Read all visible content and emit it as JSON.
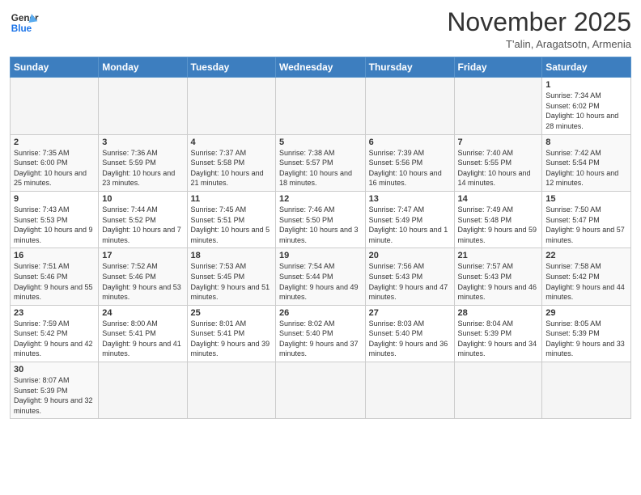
{
  "logo": {
    "text_general": "General",
    "text_blue": "Blue"
  },
  "header": {
    "month_title": "November 2025",
    "subtitle": "T'alin, Aragatsotn, Armenia"
  },
  "weekdays": [
    "Sunday",
    "Monday",
    "Tuesday",
    "Wednesday",
    "Thursday",
    "Friday",
    "Saturday"
  ],
  "weeks": [
    [
      {
        "day": "",
        "empty": true
      },
      {
        "day": "",
        "empty": true
      },
      {
        "day": "",
        "empty": true
      },
      {
        "day": "",
        "empty": true
      },
      {
        "day": "",
        "empty": true
      },
      {
        "day": "",
        "empty": true
      },
      {
        "day": "1",
        "sunrise": "Sunrise: 7:34 AM",
        "sunset": "Sunset: 6:02 PM",
        "daylight": "Daylight: 10 hours and 28 minutes."
      }
    ],
    [
      {
        "day": "2",
        "sunrise": "Sunrise: 7:35 AM",
        "sunset": "Sunset: 6:00 PM",
        "daylight": "Daylight: 10 hours and 25 minutes."
      },
      {
        "day": "3",
        "sunrise": "Sunrise: 7:36 AM",
        "sunset": "Sunset: 5:59 PM",
        "daylight": "Daylight: 10 hours and 23 minutes."
      },
      {
        "day": "4",
        "sunrise": "Sunrise: 7:37 AM",
        "sunset": "Sunset: 5:58 PM",
        "daylight": "Daylight: 10 hours and 21 minutes."
      },
      {
        "day": "5",
        "sunrise": "Sunrise: 7:38 AM",
        "sunset": "Sunset: 5:57 PM",
        "daylight": "Daylight: 10 hours and 18 minutes."
      },
      {
        "day": "6",
        "sunrise": "Sunrise: 7:39 AM",
        "sunset": "Sunset: 5:56 PM",
        "daylight": "Daylight: 10 hours and 16 minutes."
      },
      {
        "day": "7",
        "sunrise": "Sunrise: 7:40 AM",
        "sunset": "Sunset: 5:55 PM",
        "daylight": "Daylight: 10 hours and 14 minutes."
      },
      {
        "day": "8",
        "sunrise": "Sunrise: 7:42 AM",
        "sunset": "Sunset: 5:54 PM",
        "daylight": "Daylight: 10 hours and 12 minutes."
      }
    ],
    [
      {
        "day": "9",
        "sunrise": "Sunrise: 7:43 AM",
        "sunset": "Sunset: 5:53 PM",
        "daylight": "Daylight: 10 hours and 9 minutes."
      },
      {
        "day": "10",
        "sunrise": "Sunrise: 7:44 AM",
        "sunset": "Sunset: 5:52 PM",
        "daylight": "Daylight: 10 hours and 7 minutes."
      },
      {
        "day": "11",
        "sunrise": "Sunrise: 7:45 AM",
        "sunset": "Sunset: 5:51 PM",
        "daylight": "Daylight: 10 hours and 5 minutes."
      },
      {
        "day": "12",
        "sunrise": "Sunrise: 7:46 AM",
        "sunset": "Sunset: 5:50 PM",
        "daylight": "Daylight: 10 hours and 3 minutes."
      },
      {
        "day": "13",
        "sunrise": "Sunrise: 7:47 AM",
        "sunset": "Sunset: 5:49 PM",
        "daylight": "Daylight: 10 hours and 1 minute."
      },
      {
        "day": "14",
        "sunrise": "Sunrise: 7:49 AM",
        "sunset": "Sunset: 5:48 PM",
        "daylight": "Daylight: 9 hours and 59 minutes."
      },
      {
        "day": "15",
        "sunrise": "Sunrise: 7:50 AM",
        "sunset": "Sunset: 5:47 PM",
        "daylight": "Daylight: 9 hours and 57 minutes."
      }
    ],
    [
      {
        "day": "16",
        "sunrise": "Sunrise: 7:51 AM",
        "sunset": "Sunset: 5:46 PM",
        "daylight": "Daylight: 9 hours and 55 minutes."
      },
      {
        "day": "17",
        "sunrise": "Sunrise: 7:52 AM",
        "sunset": "Sunset: 5:46 PM",
        "daylight": "Daylight: 9 hours and 53 minutes."
      },
      {
        "day": "18",
        "sunrise": "Sunrise: 7:53 AM",
        "sunset": "Sunset: 5:45 PM",
        "daylight": "Daylight: 9 hours and 51 minutes."
      },
      {
        "day": "19",
        "sunrise": "Sunrise: 7:54 AM",
        "sunset": "Sunset: 5:44 PM",
        "daylight": "Daylight: 9 hours and 49 minutes."
      },
      {
        "day": "20",
        "sunrise": "Sunrise: 7:56 AM",
        "sunset": "Sunset: 5:43 PM",
        "daylight": "Daylight: 9 hours and 47 minutes."
      },
      {
        "day": "21",
        "sunrise": "Sunrise: 7:57 AM",
        "sunset": "Sunset: 5:43 PM",
        "daylight": "Daylight: 9 hours and 46 minutes."
      },
      {
        "day": "22",
        "sunrise": "Sunrise: 7:58 AM",
        "sunset": "Sunset: 5:42 PM",
        "daylight": "Daylight: 9 hours and 44 minutes."
      }
    ],
    [
      {
        "day": "23",
        "sunrise": "Sunrise: 7:59 AM",
        "sunset": "Sunset: 5:42 PM",
        "daylight": "Daylight: 9 hours and 42 minutes."
      },
      {
        "day": "24",
        "sunrise": "Sunrise: 8:00 AM",
        "sunset": "Sunset: 5:41 PM",
        "daylight": "Daylight: 9 hours and 41 minutes."
      },
      {
        "day": "25",
        "sunrise": "Sunrise: 8:01 AM",
        "sunset": "Sunset: 5:41 PM",
        "daylight": "Daylight: 9 hours and 39 minutes."
      },
      {
        "day": "26",
        "sunrise": "Sunrise: 8:02 AM",
        "sunset": "Sunset: 5:40 PM",
        "daylight": "Daylight: 9 hours and 37 minutes."
      },
      {
        "day": "27",
        "sunrise": "Sunrise: 8:03 AM",
        "sunset": "Sunset: 5:40 PM",
        "daylight": "Daylight: 9 hours and 36 minutes."
      },
      {
        "day": "28",
        "sunrise": "Sunrise: 8:04 AM",
        "sunset": "Sunset: 5:39 PM",
        "daylight": "Daylight: 9 hours and 34 minutes."
      },
      {
        "day": "29",
        "sunrise": "Sunrise: 8:05 AM",
        "sunset": "Sunset: 5:39 PM",
        "daylight": "Daylight: 9 hours and 33 minutes."
      }
    ],
    [
      {
        "day": "30",
        "sunrise": "Sunrise: 8:07 AM",
        "sunset": "Sunset: 5:39 PM",
        "daylight": "Daylight: 9 hours and 32 minutes."
      },
      {
        "day": "",
        "empty": true
      },
      {
        "day": "",
        "empty": true
      },
      {
        "day": "",
        "empty": true
      },
      {
        "day": "",
        "empty": true
      },
      {
        "day": "",
        "empty": true
      },
      {
        "day": "",
        "empty": true
      }
    ]
  ]
}
